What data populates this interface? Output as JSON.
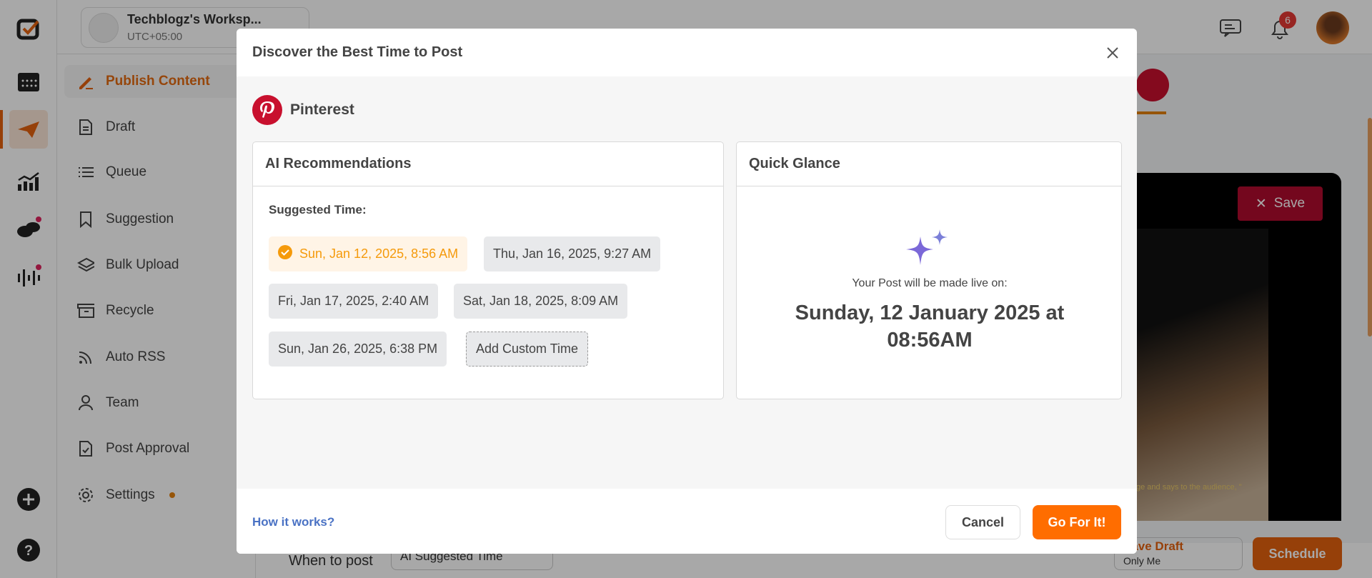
{
  "workspace": {
    "name": "Techblogz's Worksp...",
    "timezone": "UTC+05:00"
  },
  "header": {
    "notifications_count": "6"
  },
  "sidebar": {
    "items": [
      {
        "label": "Publish Content",
        "icon": "pen-icon",
        "active": true
      },
      {
        "label": "Draft",
        "icon": "document-icon"
      },
      {
        "label": "Queue",
        "icon": "list-icon"
      },
      {
        "label": "Suggestion",
        "icon": "bookmark-icon"
      },
      {
        "label": "Bulk Upload",
        "icon": "layers-icon"
      },
      {
        "label": "Recycle",
        "icon": "archive-icon",
        "expandable": true
      },
      {
        "label": "Auto RSS",
        "icon": "rss-icon"
      },
      {
        "label": "Team",
        "icon": "user-icon"
      },
      {
        "label": "Post Approval",
        "icon": "file-check-icon"
      },
      {
        "label": "Settings",
        "icon": "gear-icon",
        "expandable": true
      }
    ]
  },
  "preview": {
    "save_label": "Save",
    "caption": "ge and says to the audience, \""
  },
  "bottom_bar": {
    "when_label": "When to post",
    "when_value": "AI Suggested Time",
    "save_draft": "Save Draft",
    "visibility": "Only Me",
    "schedule": "Schedule"
  },
  "modal": {
    "title": "Discover the Best Time to Post",
    "platform": "Pinterest",
    "ai_card": {
      "title": "AI Recommendations",
      "suggested_label": "Suggested Time:",
      "times": [
        "Sun, Jan 12, 2025, 8:56 AM",
        "Thu, Jan 16, 2025, 9:27 AM",
        "Fri, Jan 17, 2025, 2:40 AM",
        "Sat, Jan 18, 2025, 8:09 AM",
        "Sun, Jan 26, 2025, 6:38 PM"
      ],
      "selected_index": 0,
      "custom_label": "Add Custom Time"
    },
    "glance_card": {
      "title": "Quick Glance",
      "subtitle": "Your Post will be made live on:",
      "date_line1": "Sunday, 12 January 2025 at",
      "date_line2": "08:56AM"
    },
    "how_link": "How it works?",
    "cancel": "Cancel",
    "confirm": "Go For It!"
  },
  "colors": {
    "accent": "#ff6d00",
    "selected_text": "#f59a0b",
    "pinterest": "#e60023",
    "link": "#4a72c4",
    "sparkle": "#7b68d8"
  }
}
